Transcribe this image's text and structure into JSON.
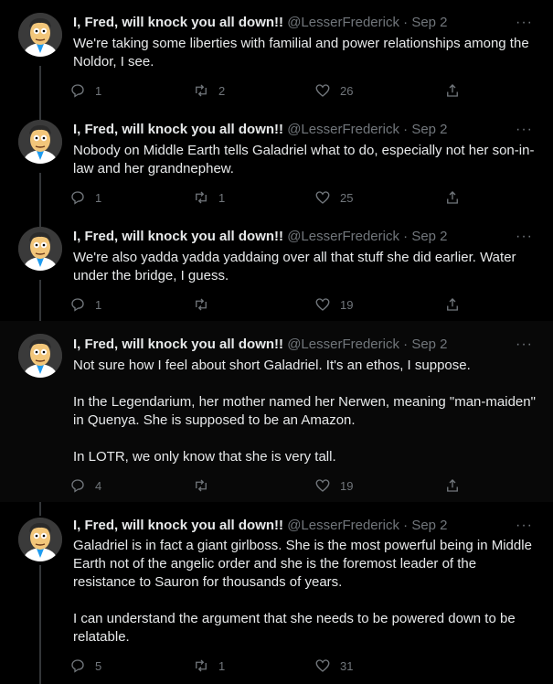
{
  "colors": {
    "background": "#000000",
    "text": "#e7e9ea",
    "muted": "#71767b",
    "thread_line": "#333639"
  },
  "tweets": [
    {
      "name": "I, Fred, will knock you all down!!",
      "handle": "@LesserFrederick",
      "date": "Sep 2",
      "body": [
        "We're taking some liberties with familial and power relationships among the Noldor, I see."
      ],
      "replies": "1",
      "retweets": "2",
      "likes": "26"
    },
    {
      "name": "I, Fred, will knock you all down!!",
      "handle": "@LesserFrederick",
      "date": "Sep 2",
      "body": [
        "Nobody on Middle Earth tells Galadriel what to do, especially not her son-in-law and her grandnephew."
      ],
      "replies": "1",
      "retweets": "1",
      "likes": "25"
    },
    {
      "name": "I, Fred, will knock you all down!!",
      "handle": "@LesserFrederick",
      "date": "Sep 2",
      "body": [
        "We're also yadda yadda yaddaing over all that stuff she did earlier. Water under the bridge, I guess."
      ],
      "replies": "1",
      "retweets": "",
      "likes": "19"
    },
    {
      "name": "I, Fred, will knock you all down!!",
      "handle": "@LesserFrederick",
      "date": "Sep 2",
      "body": [
        "Not sure how I feel about short Galadriel. It's an ethos, I suppose.",
        "In the Legendarium, her mother named her Nerwen, meaning \"man-maiden\" in Quenya. She is supposed to be an Amazon.",
        "In LOTR, we only know that she is very tall."
      ],
      "replies": "4",
      "retweets": "",
      "likes": "19"
    },
    {
      "name": "I, Fred, will knock you all down!!",
      "handle": "@LesserFrederick",
      "date": "Sep 2",
      "body": [
        "Galadriel is in fact a giant girlboss. She is the most powerful being in Middle Earth not of the angelic order and she is the foremost leader of the resistance to Sauron for thousands of years.",
        "I can understand the argument that she needs to be powered down to be relatable."
      ],
      "replies": "5",
      "retweets": "1",
      "likes": "31"
    }
  ],
  "icons": {
    "more": "more-dots-icon",
    "reply": "reply-icon",
    "retweet": "retweet-icon",
    "like": "heart-icon",
    "share": "share-icon"
  }
}
